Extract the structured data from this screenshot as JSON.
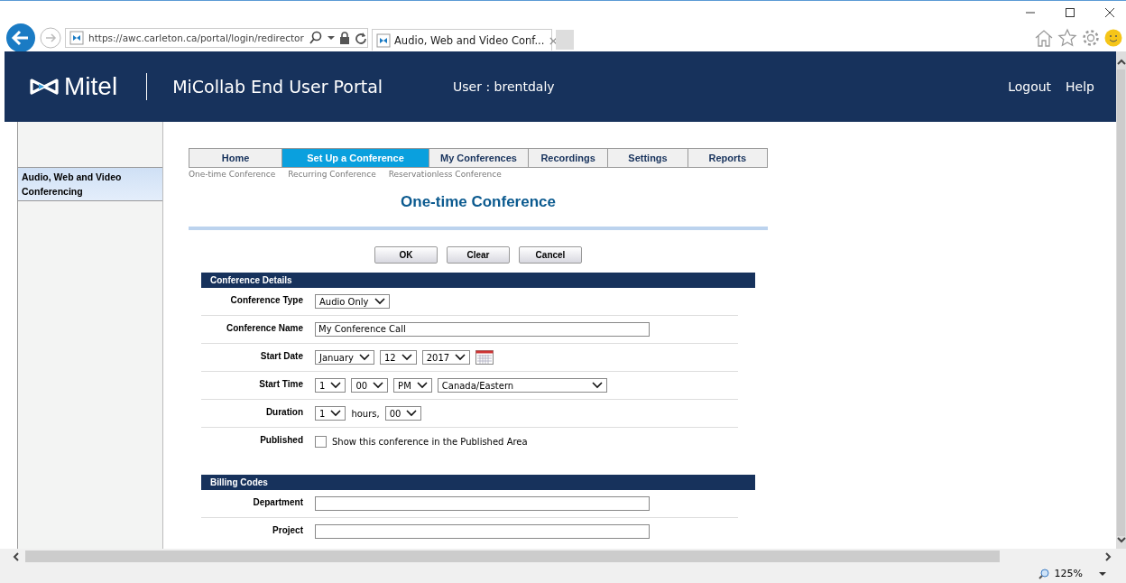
{
  "browser": {
    "url": "https://awc.carleton.ca/portal/login/redirector",
    "tab_title": "Audio, Web and Video Conf...",
    "tab_close": "×"
  },
  "header": {
    "logo": "Mitel",
    "title": "MiCollab End User Portal",
    "user": "User : brentdaly",
    "links": [
      "Logout",
      "Help"
    ]
  },
  "sidebar": {
    "items": [
      {
        "label": "Audio, Web and Video Conferencing",
        "selected": true
      }
    ]
  },
  "tabs": [
    {
      "label": "Home",
      "selected": false
    },
    {
      "label": "Set Up a Conference",
      "selected": true
    },
    {
      "label": "My Conferences",
      "selected": false
    },
    {
      "label": "Recordings",
      "selected": false
    },
    {
      "label": "Settings",
      "selected": false
    },
    {
      "label": "Reports",
      "selected": false
    }
  ],
  "subtabs": [
    "One-time Conference",
    "Recurring Conference",
    "Reservationless Conference"
  ],
  "page_title": "One-time Conference",
  "buttons": [
    "OK",
    "Clear",
    "Cancel"
  ],
  "sections": [
    {
      "title": "Conference Details",
      "fields": [
        {
          "label": "Conference Type",
          "controls": [
            {
              "kind": "select",
              "value": "Audio Only"
            }
          ]
        },
        {
          "label": "Conference Name",
          "controls": [
            {
              "kind": "text",
              "value": "My Conference Call"
            }
          ]
        },
        {
          "label": "Start Date",
          "controls": [
            {
              "kind": "select",
              "value": "January"
            },
            {
              "kind": "select",
              "value": "12"
            },
            {
              "kind": "select",
              "value": "2017"
            },
            {
              "kind": "calendar"
            }
          ]
        },
        {
          "label": "Start Time",
          "controls": [
            {
              "kind": "select",
              "value": "1"
            },
            {
              "kind": "select",
              "value": "00"
            },
            {
              "kind": "select",
              "value": "PM"
            },
            {
              "kind": "wide_select",
              "value": "Canada/Eastern"
            }
          ]
        },
        {
          "label": "Duration",
          "controls": [
            {
              "kind": "select",
              "value": "1"
            },
            {
              "kind": "note",
              "value": "hours,"
            },
            {
              "kind": "select",
              "value": "00"
            }
          ]
        },
        {
          "label": "Published",
          "controls": [
            {
              "kind": "checkbox",
              "checked": false,
              "value": "Show this conference in the Published Area"
            }
          ]
        }
      ]
    },
    {
      "title": "Billing Codes",
      "fields": [
        {
          "label": "Department",
          "controls": [
            {
              "kind": "text"
            }
          ]
        },
        {
          "label": "Project",
          "controls": [
            {
              "kind": "text"
            }
          ]
        }
      ]
    }
  ],
  "status_bar": {
    "zoom": "125%"
  }
}
